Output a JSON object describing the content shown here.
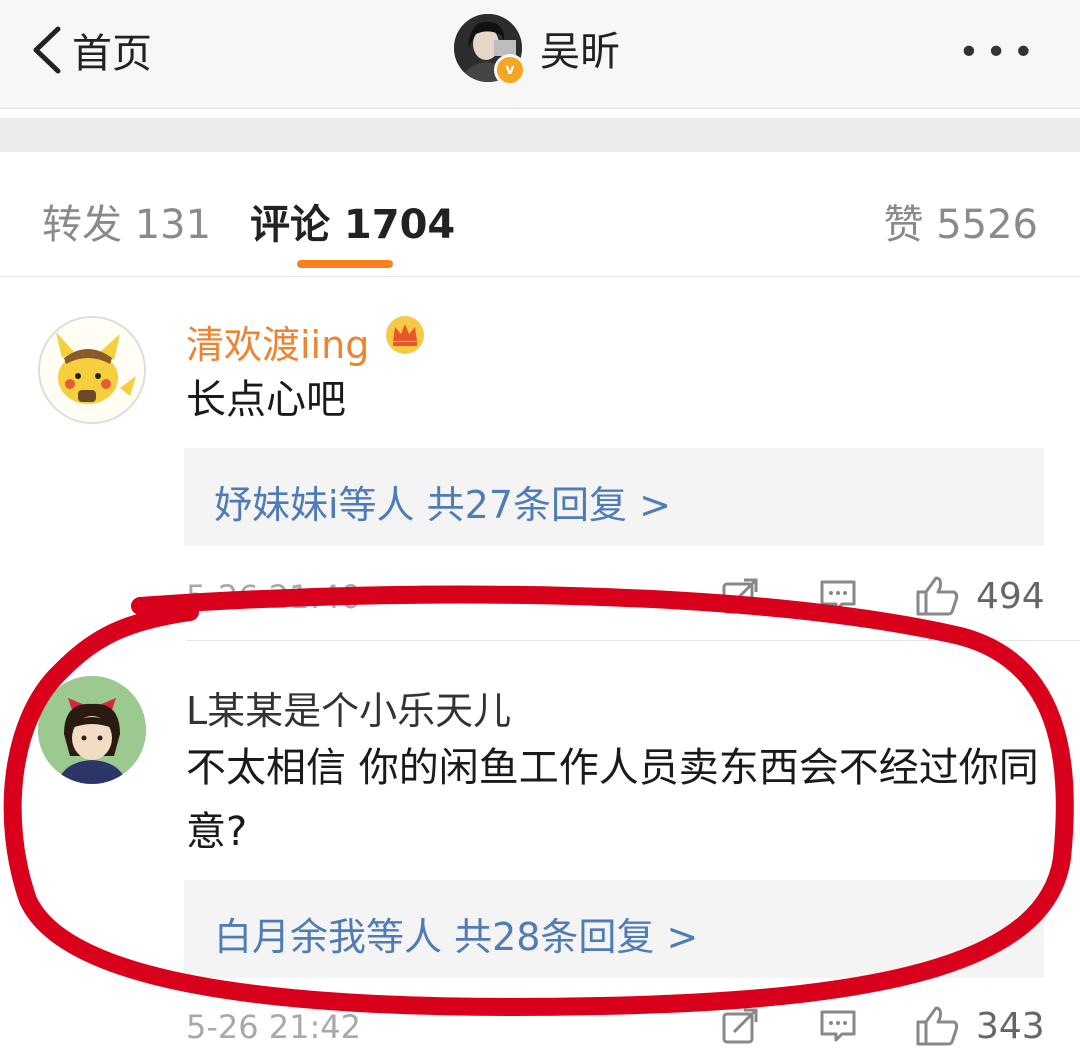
{
  "nav": {
    "back_label": "首页",
    "title": "吴昕",
    "more": "•••",
    "verified_badge": "v"
  },
  "tabs": {
    "repost": "转发 131",
    "comment": "评论 1704",
    "like": "赞 5526"
  },
  "comments": [
    {
      "user": "清欢渡iing",
      "text": "长点心吧",
      "replies": "妤妹妹i等人  共27条回复 >",
      "time": "5-26 21:40",
      "likes": "494",
      "icons": [
        "share-icon",
        "comment-icon",
        "thumbs-up-icon"
      ]
    },
    {
      "user": "L某某是个小乐天儿",
      "text": "不太相信 你的闲鱼工作人员卖东西会不经过你同意?",
      "replies": "白月余我等人  共28条回复 >",
      "time": "5-26 21:42",
      "likes": "343",
      "icons": [
        "share-icon",
        "comment-icon",
        "thumbs-up-icon"
      ]
    }
  ],
  "colors": {
    "accent": "#f7811b",
    "link": "#4f7cb4",
    "annotation_ring": "#d9001b"
  }
}
